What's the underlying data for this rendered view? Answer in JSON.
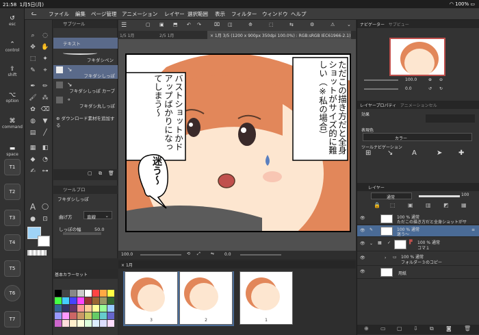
{
  "status": {
    "time": "21:58",
    "date": "1月5日(月)",
    "battery": "100%"
  },
  "menu": [
    "ファイル",
    "編集",
    "ページ管理",
    "アニメーション",
    "レイヤー",
    "選択範囲",
    "表示",
    "フィルター",
    "ウィンドウ",
    "ヘルプ"
  ],
  "left_keys": [
    {
      "glyph": "esc",
      "label": "esc"
    },
    {
      "glyph": "⇧",
      "label": "control"
    },
    {
      "glyph": "⇧",
      "label": "shift"
    },
    {
      "glyph": "⌥",
      "label": "option"
    },
    {
      "glyph": "⌘",
      "label": "command"
    },
    {
      "glyph": "▬",
      "label": "space"
    }
  ],
  "tkeys": [
    "T1",
    "T2",
    "T3",
    "T4",
    "T5",
    "T6",
    "T7"
  ],
  "subtool": {
    "header": "サブツール",
    "items": [
      "テキスト",
      "フキダシペン",
      "フキダシしっぽ",
      "フキダシしっぽ カーブ",
      "フキダシ丸しっぽ"
    ],
    "download": "ダウンロード素材を追加する",
    "prop_header": "ツールプロ",
    "prop_title": "フキダシしっぽ",
    "bend_label": "曲げ方",
    "bend_value": "直線",
    "width_label": "しっぽの幅",
    "width_value": "50.0"
  },
  "canvas_tabs": {
    "t1": "1/5",
    "t2": "1月",
    "t3": "2/5",
    "t4": "1月",
    "info": "× 1月 3/5 (1200 x 900px 350dpi 100.0%) : RGB:sRGB IEC61966-2.1)"
  },
  "balloons": {
    "right": "ただこの描き方だと全身ショットがサイズ的に難しい（※私の場合）",
    "left": "バストショットかドアップばかりになってしまう〜",
    "small": "迷う〜"
  },
  "zoom": {
    "value": "100.0",
    "rot": "0.0"
  },
  "pages": {
    "tab": "1月",
    "items": [
      "3",
      "2",
      "1"
    ]
  },
  "colorset": {
    "header": "基本カラーセット"
  },
  "navigator": {
    "tab1": "ナビゲーター",
    "tab2": "サブビュー",
    "zoom": "100.0",
    "rot": "0.0"
  },
  "layerprop": {
    "tab1": "レイヤープロパティ",
    "tab2": "アニメーションセル",
    "effect": "効果",
    "express": "表現色",
    "color": "カラー",
    "toolnav": "ツールナビゲーション"
  },
  "layers": {
    "tab": "レイヤー",
    "blend": "通常",
    "opacity": "100",
    "items": [
      {
        "pct": "100 %",
        "mode": "通常",
        "name": "ただこの描き方だと全身ショットがサ"
      },
      {
        "pct": "100 %",
        "mode": "通常",
        "name": "迷う〜"
      },
      {
        "pct": "100 %",
        "mode": "通常",
        "name": "コマ１"
      },
      {
        "pct": "100 %",
        "mode": "通常",
        "name": "フォルダー３のコピー"
      },
      {
        "pct": "",
        "mode": "",
        "name": "用紙"
      }
    ]
  },
  "colors": {
    "main": "#9fd3f6",
    "sub": "#ffffff",
    "accent": "#5a7fbf",
    "hair": "#e2875a",
    "skin": "#fde6d0"
  }
}
